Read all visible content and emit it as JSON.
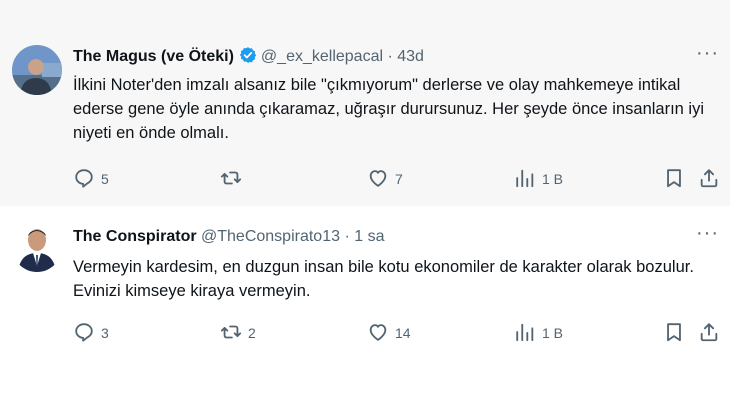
{
  "tweets": [
    {
      "display_name": "The Magus (ve Öteki)",
      "verified": true,
      "handle": "@_ex_kellepacal",
      "separator": "·",
      "time": "43d",
      "text": "İlkini Noter'den imzalı alsanız bile \"çıkmıyorum\" derlerse ve olay mahkemeye intikal ederse gene  öyle anında çıkaramaz, uğraşır durursunuz. Her şeyde önce insanların iyi niyeti en önde olmalı.",
      "more_label": "···",
      "actions": {
        "reply": "5",
        "retweet": "",
        "like": "7",
        "views": "1 B"
      }
    },
    {
      "display_name": "The Conspirator",
      "verified": false,
      "handle": "@TheConspirato13",
      "separator": "·",
      "time": "1 sa",
      "text": "Vermeyin kardesim, en duzgun insan bile kotu ekonomiler de karakter olarak bozulur. Evinizi kimseye kiraya vermeyin.",
      "more_label": "···",
      "actions": {
        "reply": "3",
        "retweet": "2",
        "like": "14",
        "views": "1 B"
      }
    }
  ],
  "colors": {
    "muted": "#536471",
    "verified_blue": "#1d9bf0",
    "text": "#0f1419",
    "highlight_bg": "#f7f7f7"
  }
}
